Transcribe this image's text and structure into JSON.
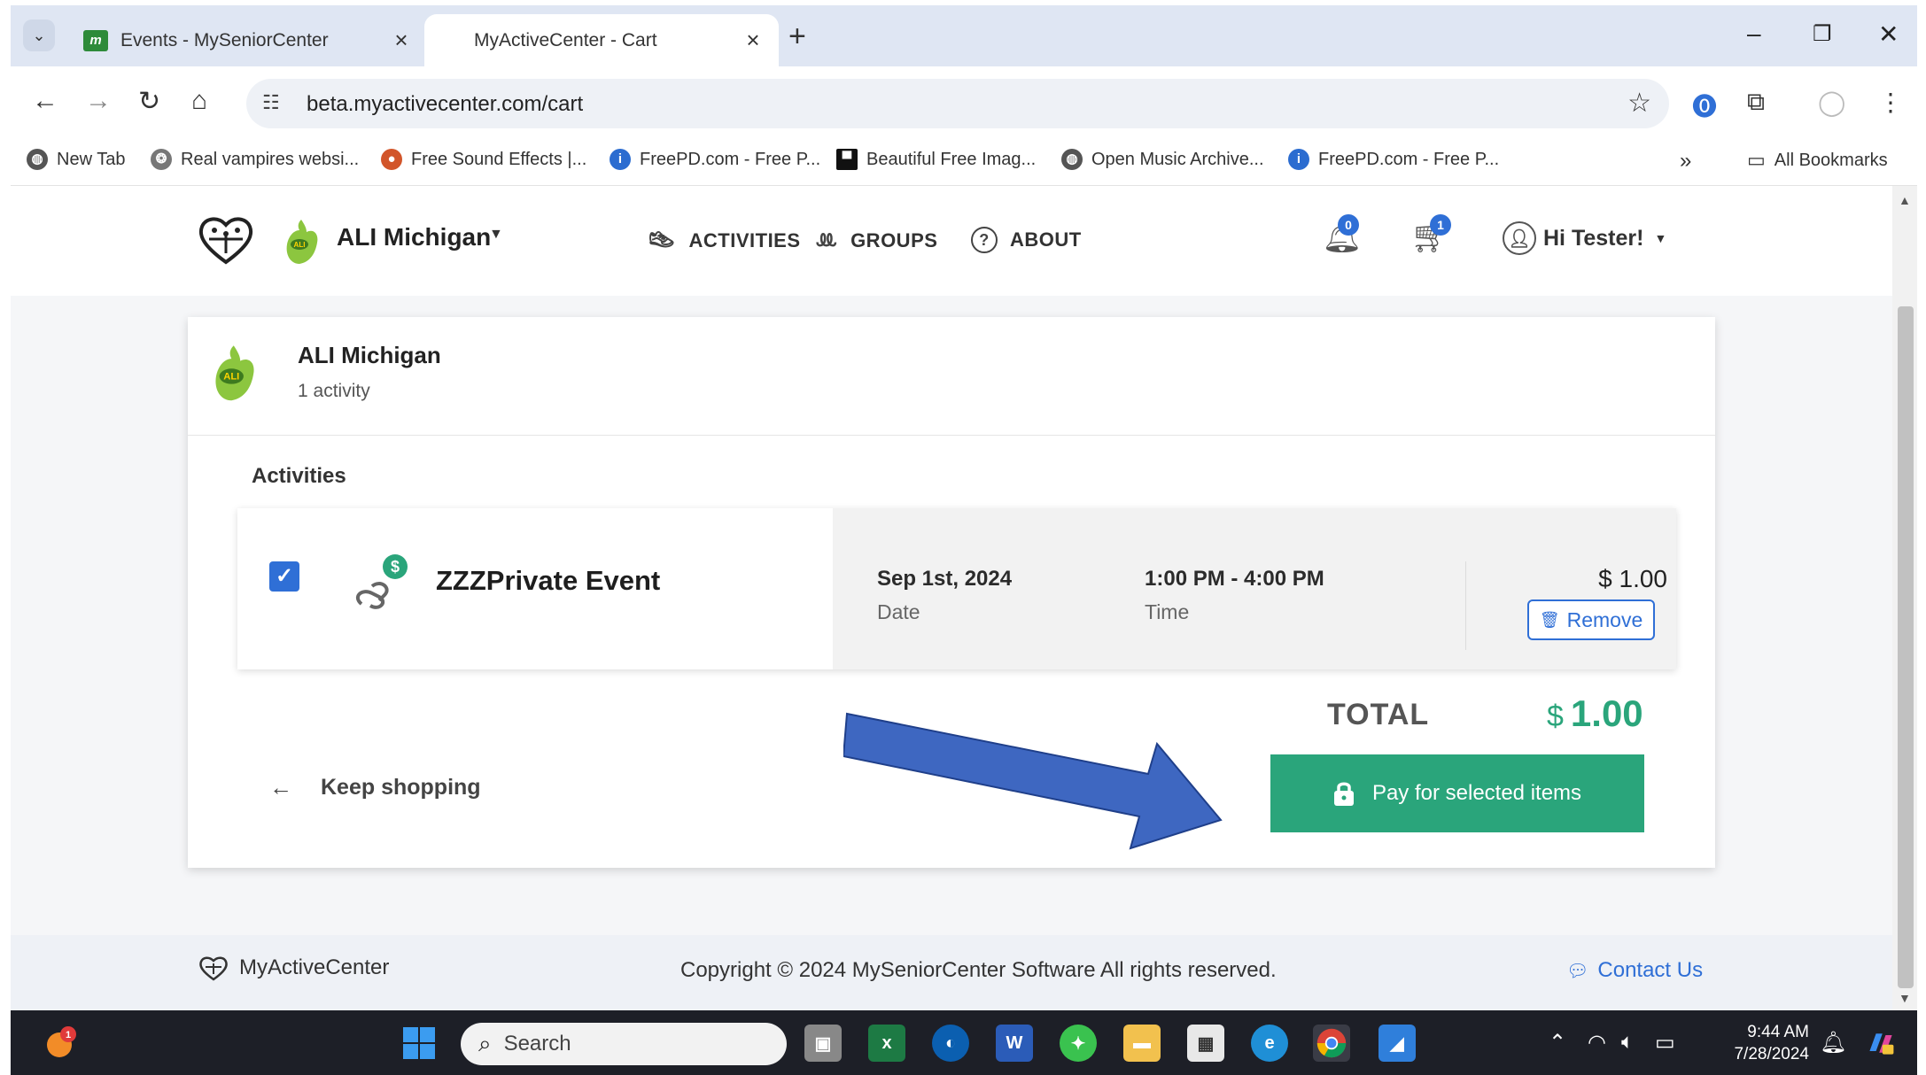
{
  "browser": {
    "tabs": [
      {
        "title": "Events - MySeniorCenter",
        "favicon": "m-logo-icon",
        "active": false
      },
      {
        "title": "MyActiveCenter - Cart",
        "active": true
      }
    ],
    "url": "beta.myactivecenter.com/cart",
    "bookmarks": [
      {
        "label": "New Tab"
      },
      {
        "label": "Real vampires websi..."
      },
      {
        "label": "Free Sound Effects |..."
      },
      {
        "label": "FreePD.com - Free P..."
      },
      {
        "label": "Beautiful Free Imag..."
      },
      {
        "label": "Open Music Archive..."
      },
      {
        "label": "FreePD.com - Free P..."
      }
    ],
    "all_bookmarks": "All Bookmarks"
  },
  "header": {
    "org_name": "ALI Michigan",
    "nav": [
      {
        "label": "ACTIVITIES",
        "icon": "shoe-icon"
      },
      {
        "label": "GROUPS",
        "icon": "people-icon"
      },
      {
        "label": "ABOUT",
        "icon": "question-icon"
      }
    ],
    "notifications_count": "0",
    "cart_count": "1",
    "greeting": "Hi Tester!"
  },
  "cart": {
    "org_name": "ALI Michigan",
    "activity_count": "1 activity",
    "section_label": "Activities",
    "items": [
      {
        "name": "ZZZPrivate Event",
        "checked": true,
        "date": "Sep 1st, 2024",
        "date_label": "Date",
        "time": "1:00 PM - 4:00 PM",
        "time_label": "Time",
        "price": "$ 1.00",
        "remove_label": "Remove"
      }
    ],
    "total_label": "TOTAL",
    "total_currency": "$",
    "total_amount": "1.00",
    "keep_shopping": "Keep shopping",
    "pay_label": "Pay for selected items"
  },
  "footer": {
    "brand": "MyActiveCenter",
    "copyright": "Copyright © 2024 MySeniorCenter Software All rights reserved.",
    "contact": "Contact Us"
  },
  "taskbar": {
    "search_placeholder": "Search",
    "notification_badge": "1",
    "time": "9:44 AM",
    "date": "7/28/2024"
  },
  "colors": {
    "accent_blue": "#2f6fd6",
    "accent_green": "#2aa57b",
    "annotation_arrow": "#3e67c1"
  }
}
